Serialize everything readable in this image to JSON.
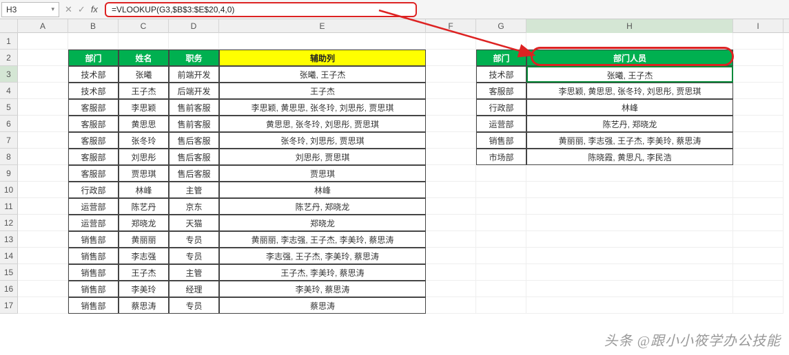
{
  "name_box": "H3",
  "fx_label": "fx",
  "formula": "=VLOOKUP(G3,$B$3:$E$20,4,0)",
  "columns": [
    "",
    "A",
    "B",
    "C",
    "D",
    "E",
    "F",
    "G",
    "H",
    "I"
  ],
  "row_labels": [
    "1",
    "2",
    "3",
    "4",
    "5",
    "6",
    "7",
    "8",
    "9",
    "10",
    "11",
    "12",
    "13",
    "14",
    "15",
    "16",
    "17"
  ],
  "left_headers": {
    "dept": "部门",
    "name": "姓名",
    "role": "职务",
    "aux": "辅助列"
  },
  "right_headers": {
    "dept": "部门",
    "people": "部门人员"
  },
  "left_table": [
    {
      "dept": "技术部",
      "name": "张曦",
      "role": "前端开发",
      "aux": "张曦, 王子杰"
    },
    {
      "dept": "技术部",
      "name": "王子杰",
      "role": "后端开发",
      "aux": "王子杰"
    },
    {
      "dept": "客服部",
      "name": "李思颖",
      "role": "售前客服",
      "aux": "李思颖, 黄思思, 张冬玲, 刘思彤, 贾思琪"
    },
    {
      "dept": "客服部",
      "name": "黄思思",
      "role": "售前客服",
      "aux": "黄思思, 张冬玲, 刘思彤, 贾思琪"
    },
    {
      "dept": "客服部",
      "name": "张冬玲",
      "role": "售后客服",
      "aux": "张冬玲, 刘思彤, 贾思琪"
    },
    {
      "dept": "客服部",
      "name": "刘思彤",
      "role": "售后客服",
      "aux": "刘思彤, 贾思琪"
    },
    {
      "dept": "客服部",
      "name": "贾思琪",
      "role": "售后客服",
      "aux": "贾思琪"
    },
    {
      "dept": "行政部",
      "name": "林峰",
      "role": "主管",
      "aux": "林峰"
    },
    {
      "dept": "运营部",
      "name": "陈艺丹",
      "role": "京东",
      "aux": "陈艺丹, 郑晓龙"
    },
    {
      "dept": "运营部",
      "name": "郑晓龙",
      "role": "天猫",
      "aux": "郑晓龙"
    },
    {
      "dept": "销售部",
      "name": "黄丽丽",
      "role": "专员",
      "aux": "黄丽丽, 李志强, 王子杰, 李美玲, 蔡思涛"
    },
    {
      "dept": "销售部",
      "name": "李志强",
      "role": "专员",
      "aux": "李志强, 王子杰, 李美玲, 蔡思涛"
    },
    {
      "dept": "销售部",
      "name": "王子杰",
      "role": "主管",
      "aux": "王子杰, 李美玲, 蔡思涛"
    },
    {
      "dept": "销售部",
      "name": "李美玲",
      "role": "经理",
      "aux": "李美玲, 蔡思涛"
    },
    {
      "dept": "销售部",
      "name": "蔡思涛",
      "role": "专员",
      "aux": "蔡思涛"
    }
  ],
  "right_table": [
    {
      "dept": "技术部",
      "people": "张曦, 王子杰"
    },
    {
      "dept": "客服部",
      "people": "李思颖, 黄思思, 张冬玲, 刘思彤, 贾思琪"
    },
    {
      "dept": "行政部",
      "people": "林峰"
    },
    {
      "dept": "运营部",
      "people": "陈艺丹, 郑晓龙"
    },
    {
      "dept": "销售部",
      "people": "黄丽丽, 李志强, 王子杰, 李美玲, 蔡思涛"
    },
    {
      "dept": "市场部",
      "people": "陈晓霞, 黄思凡, 李民浩"
    }
  ],
  "watermark": "头条 @跟小小筱学办公技能"
}
